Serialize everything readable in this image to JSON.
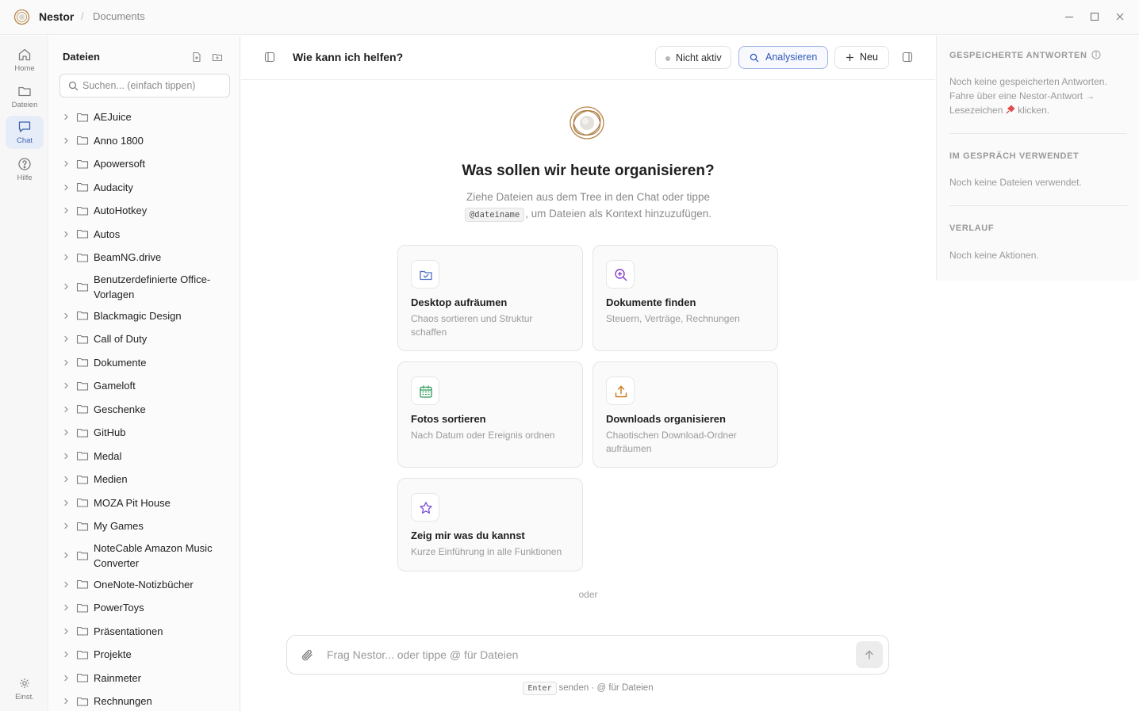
{
  "titlebar": {
    "app_name": "Nestor",
    "separator": "/",
    "breadcrumb": "Documents"
  },
  "rail": {
    "home": "Home",
    "files": "Dateien",
    "chat": "Chat",
    "help": "Hilfe",
    "settings": "Einst."
  },
  "tree": {
    "title": "Dateien",
    "search_placeholder": "Suchen... (einfach tippen)",
    "items": [
      "AEJuice",
      "Anno 1800",
      "Apowersoft",
      "Audacity",
      "AutoHotkey",
      "Autos",
      "BeamNG.drive",
      "Benutzerdefinierte Office-Vorlagen",
      "Blackmagic Design",
      "Call of Duty",
      "Dokumente",
      "Gameloft",
      "Geschenke",
      "GitHub",
      "Medal",
      "Medien",
      "MOZA Pit House",
      "My Games",
      "NoteCable Amazon Music Converter",
      "OneNote-Notizbücher",
      "PowerToys",
      "Präsentationen",
      "Projekte",
      "Rainmeter",
      "Rechnungen"
    ]
  },
  "header": {
    "title": "Wie kann ich helfen?",
    "status": "Nicht aktiv",
    "analyze": "Analysieren",
    "new": "Neu"
  },
  "hero": {
    "title": "Was sollen wir heute organisieren?",
    "subtitle_line1": "Ziehe Dateien aus dem Tree in den Chat oder tippe",
    "code": "@dateiname",
    "subtitle_line2": ", um Dateien als Kontext hinzuzufügen."
  },
  "cards": [
    {
      "title": "Desktop aufräumen",
      "desc": "Chaos sortieren und Struktur schaffen",
      "icon": "folder-check-icon",
      "color": "#4a6fc4"
    },
    {
      "title": "Dokumente finden",
      "desc": "Steuern, Verträge, Rechnungen",
      "icon": "search-plus-icon",
      "color": "#8a3fc8"
    },
    {
      "title": "Fotos sortieren",
      "desc": "Nach Datum oder Ereignis ordnen",
      "icon": "calendar-icon",
      "color": "#2e9a5a"
    },
    {
      "title": "Downloads organisieren",
      "desc": "Chaotischen Download-Ordner aufräumen",
      "icon": "upload-icon",
      "color": "#c77a1e"
    },
    {
      "title": "Zeig mir was du kannst",
      "desc": "Kurze Einführung in alle Funktionen",
      "icon": "star-icon",
      "color": "#7a4fd6"
    }
  ],
  "separator_text": "oder",
  "composer": {
    "placeholder": "Frag Nestor... oder tippe @ für Dateien",
    "hint_key": "Enter",
    "hint_text": "senden · @ für Dateien"
  },
  "right_panel": {
    "saved_title": "GESPEICHERTE ANTWORTEN",
    "saved_text_part1": "Noch keine gespeicherten Antworten. Fahre über eine Nestor-Antwort → Lesezeichen",
    "saved_text_part2": "klicken.",
    "used_title": "IM GESPRÄCH VERWENDET",
    "used_text": "Noch keine Dateien verwendet.",
    "history_title": "VERLAUF",
    "history_text": "Noch keine Aktionen."
  },
  "colors": {
    "accent": "#3359b5",
    "active_rail_bg": "#e6edf9",
    "logo_gold": "#b8864b"
  }
}
